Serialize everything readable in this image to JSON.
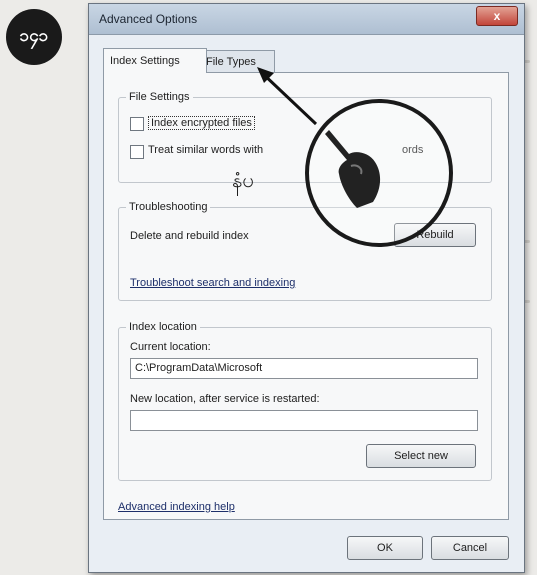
{
  "page": {
    "badge_text": "၁၄၁",
    "note_glyph": "နံပ"
  },
  "dialog": {
    "title": "Advanced Options",
    "close_label": "x",
    "tabs": [
      {
        "label": "Index Settings",
        "active": true
      },
      {
        "label": "File Types",
        "active": false
      }
    ],
    "file_settings": {
      "legend": "File Settings",
      "index_encrypted_label": "Index encrypted files",
      "treat_similar_label_start": "Treat similar words with",
      "treat_similar_label_end": "ords"
    },
    "troubleshooting": {
      "legend": "Troubleshooting",
      "delete_rebuild_label": "Delete and rebuild index",
      "rebuild_button": "Rebuild",
      "troubleshoot_link": "Troubleshoot search and indexing"
    },
    "index_location": {
      "legend": "Index location",
      "current_label": "Current location:",
      "current_value": "C:\\ProgramData\\Microsoft",
      "new_label": "New location, after service is restarted:",
      "new_value": "",
      "select_new_button": "Select new"
    },
    "help_link": "Advanced indexing help",
    "ok_button": "OK",
    "cancel_button": "Cancel"
  }
}
